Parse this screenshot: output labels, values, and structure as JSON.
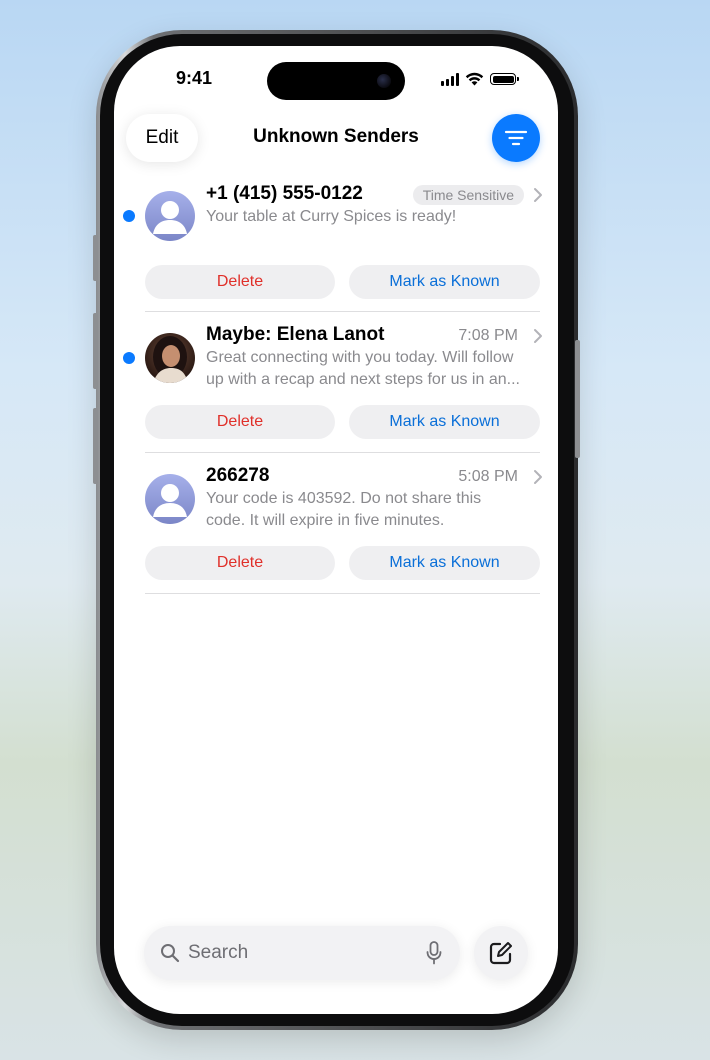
{
  "status_bar": {
    "time": "9:41"
  },
  "nav": {
    "edit_label": "Edit",
    "title": "Unknown Senders"
  },
  "messages": [
    {
      "sender": "+1 (415) 555-0122",
      "badge": "Time Sensitive",
      "preview": "Your table at Curry Spices is ready!",
      "unread": true,
      "avatar": "person-placeholder-icon",
      "delete_label": "Delete",
      "known_label": "Mark as Known"
    },
    {
      "sender": "Maybe: Elena Lanot",
      "time": "7:08 PM",
      "preview_line1": "Great connecting with you today. Will follow",
      "preview_line2": "up with a recap and next steps for us in an...",
      "unread": true,
      "avatar": "contact-photo",
      "delete_label": "Delete",
      "known_label": "Mark as Known"
    },
    {
      "sender": "266278",
      "time": "5:08 PM",
      "preview_line1": "Your code is 403592. Do not share this",
      "preview_line2": "code. It will expire in five minutes.",
      "unread": false,
      "avatar": "person-placeholder-icon",
      "delete_label": "Delete",
      "known_label": "Mark as Known"
    }
  ],
  "search": {
    "placeholder": "Search"
  },
  "colors": {
    "accent": "#0a7aff",
    "delete": "#e0302a",
    "known": "#0a6fd8",
    "secondary_text": "#8a8a8e"
  }
}
